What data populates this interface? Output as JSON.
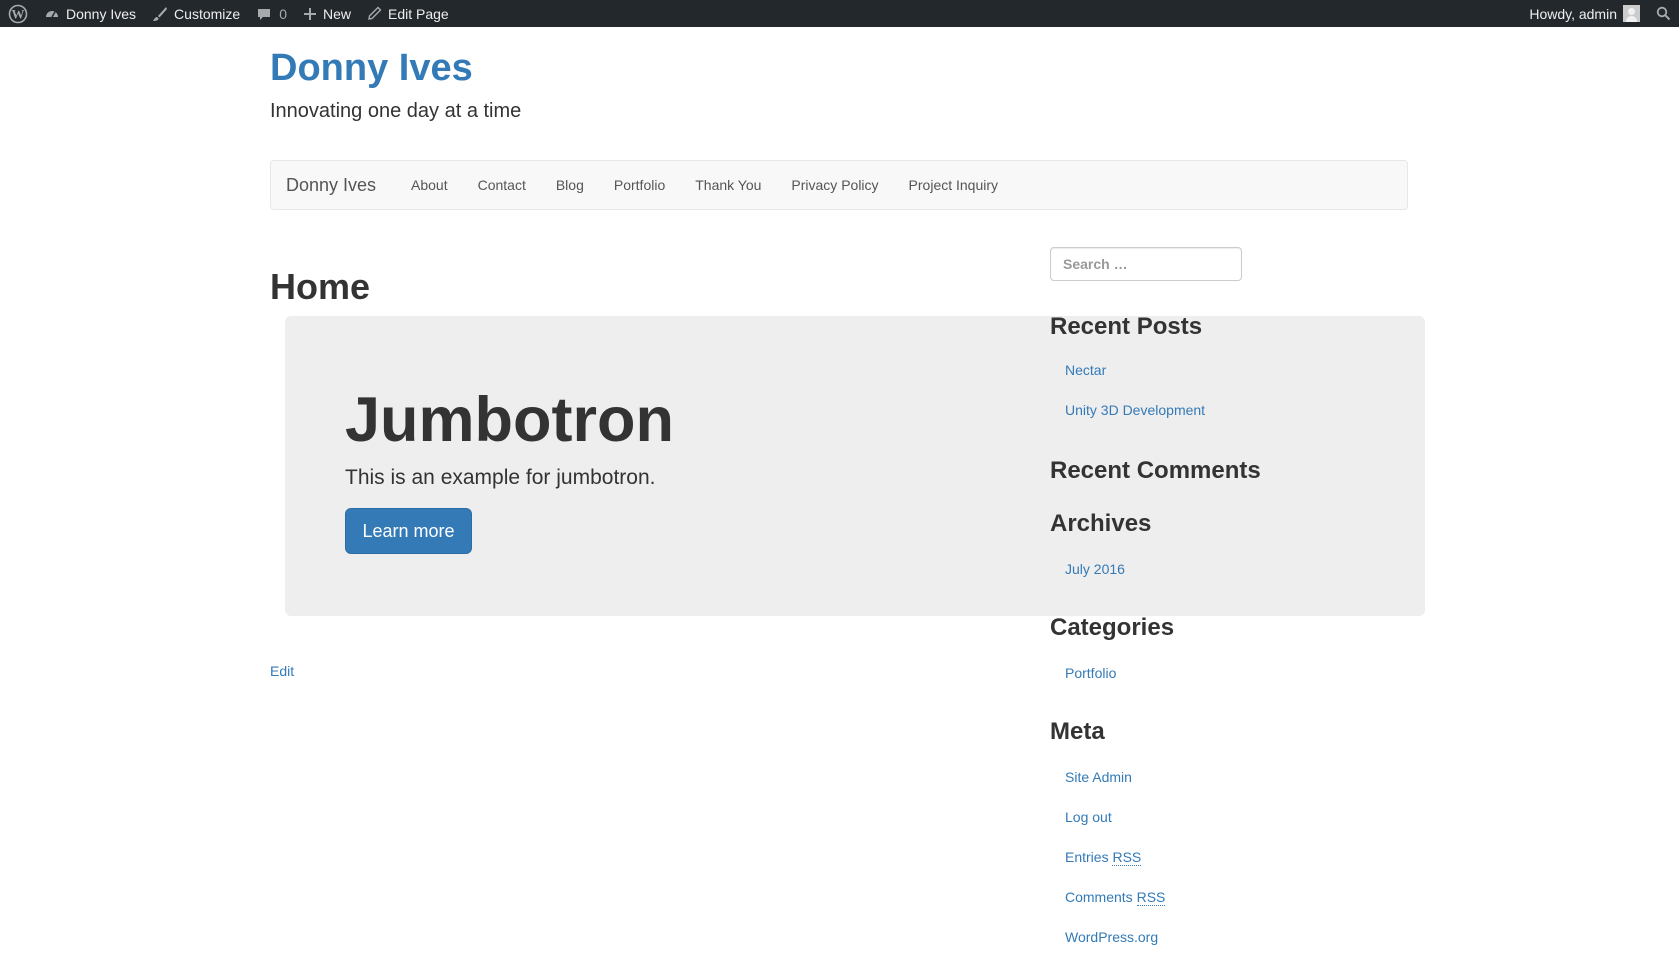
{
  "admin_bar": {
    "site_name": "Donny Ives",
    "customize": "Customize",
    "comments_count": "0",
    "new": "New",
    "edit_page": "Edit Page",
    "howdy": "Howdy, admin"
  },
  "site": {
    "title": "Donny Ives",
    "description": "Innovating one day at a time"
  },
  "navbar": {
    "brand": "Donny Ives",
    "items": [
      "About",
      "Contact",
      "Blog",
      "Portfolio",
      "Thank You",
      "Privacy Policy",
      "Project Inquiry"
    ]
  },
  "page": {
    "title": "Home",
    "edit_link": "Edit"
  },
  "jumbotron": {
    "heading": "Jumbotron",
    "text": "This is an example for jumbotron.",
    "button": "Learn more"
  },
  "sidebar": {
    "search_placeholder": "Search …",
    "recent_posts": {
      "title": "Recent Posts",
      "items": [
        "Nectar",
        "Unity 3D Development"
      ]
    },
    "recent_comments": {
      "title": "Recent Comments"
    },
    "archives": {
      "title": "Archives",
      "items": [
        "July 2016"
      ]
    },
    "categories": {
      "title": "Categories",
      "items": [
        "Portfolio"
      ]
    },
    "meta": {
      "title": "Meta",
      "site_admin": "Site Admin",
      "log_out": "Log out",
      "entries_prefix": "Entries ",
      "comments_prefix": "Comments ",
      "rss": "RSS",
      "wordpress_org": "WordPress.org"
    }
  },
  "colors": {
    "admin_bar_bg": "#23282d",
    "link": "#337ab7",
    "jumbotron_bg": "#eeeeee",
    "navbar_bg": "#f8f8f8"
  }
}
